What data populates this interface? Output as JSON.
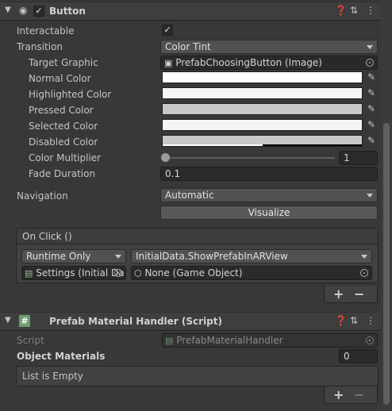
{
  "button_component": {
    "title": "Button",
    "enabled": "✓",
    "interactable_label": "Interactable",
    "interactable_value": "✓",
    "transition_label": "Transition",
    "transition_value": "Color Tint",
    "target_graphic_label": "Target Graphic",
    "target_graphic_value": "PrefabChoosingButton (Image)",
    "normal_color_label": "Normal Color",
    "highlighted_color_label": "Highlighted Color",
    "pressed_color_label": "Pressed Color",
    "selected_color_label": "Selected Color",
    "disabled_color_label": "Disabled Color",
    "colors": {
      "normal": "#ffffff",
      "highlighted": "#f5f5f5",
      "pressed": "#c8c8c8",
      "selected": "#f5f5f5",
      "disabled": "#c8c8c8"
    },
    "color_multiplier_label": "Color Multiplier",
    "color_multiplier_value": "1",
    "fade_duration_label": "Fade Duration",
    "fade_duration_value": "0.1",
    "navigation_label": "Navigation",
    "navigation_value": "Automatic",
    "visualize_label": "Visualize",
    "on_click": {
      "title": "On Click ()",
      "runtime_value": "Runtime Only",
      "function_value": "InitialData.ShowPrefabInARView",
      "object_value": "Settings (Initial Da",
      "argument_value": "None (Game Object)",
      "plus": "+",
      "minus": "−"
    }
  },
  "prefab_component": {
    "title": "Prefab Material Handler (Script)",
    "script_label": "Script",
    "script_value": "PrefabMaterialHandler",
    "object_materials_label": "Object Materials",
    "object_materials_count": "0",
    "list_empty": "List is Empty",
    "plus": "+",
    "minus": "−"
  }
}
